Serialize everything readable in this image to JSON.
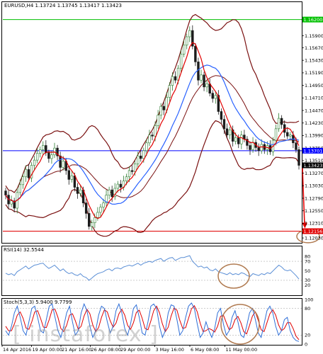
{
  "colors": {
    "background": "#ffffff",
    "candle_up": "#2e7d32",
    "candle_down": "#1b1b1b",
    "ma_fast": "#e00000",
    "ma_slow": "#2962ff",
    "bands": "#7a1010",
    "hline_green": "#00c000",
    "hline_blue": "#0000ff",
    "hline_red": "#e00000",
    "rsi": "#5b8fd6",
    "stoch_main": "#2f6fd8",
    "stoch_signal": "#e00000",
    "circle": "#b07a50",
    "arrow": "#e00000"
  },
  "chart_data": [
    {
      "type": "candlestick",
      "info": "EURUSD,H4  1.13724 1.13745 1.13417 1.13423",
      "y_range": [
        1.1195,
        1.1653
      ],
      "x_labels": [
        "14 Apr 2016",
        "19 Apr 00:00",
        "21 Apr 16:00",
        "26 Apr 08:00",
        "29 Apr 00:00",
        "3 May 16:00",
        "6 May 08:00",
        "11 May 00:00"
      ],
      "y_ticks": [
        "1.15900",
        "1.15670",
        "1.15430",
        "1.15190",
        "1.14950",
        "1.14710",
        "1.14470",
        "1.14230",
        "1.13990",
        "1.13750",
        "1.13510",
        "1.13270",
        "1.13030",
        "1.12790",
        "1.12550",
        "1.12310",
        "1.12030"
      ],
      "price_labels": [
        {
          "text": "1.16200",
          "value": 1.1621,
          "color": "#00c000"
        },
        {
          "text": "1.13701",
          "value": 1.137,
          "color": "#0000ff"
        },
        {
          "text": "1.13423",
          "value": 1.1342,
          "color": "#000000"
        },
        {
          "text": "1.12156",
          "value": 1.1216,
          "color": "#e00000"
        }
      ],
      "levels": [
        {
          "value": 1.1621,
          "color": "#00c000"
        },
        {
          "value": 1.137,
          "color": "#0000ff"
        },
        {
          "value": 1.1216,
          "color": "#e00000"
        }
      ],
      "close": [
        1.1285,
        1.1268,
        1.1274,
        1.126,
        1.129,
        1.1305,
        1.132,
        1.1334,
        1.1318,
        1.1342,
        1.1352,
        1.1365,
        1.1372,
        1.138,
        1.1366,
        1.1355,
        1.1362,
        1.1375,
        1.136,
        1.1338,
        1.135,
        1.1332,
        1.1315,
        1.1322,
        1.13,
        1.1288,
        1.1295,
        1.127,
        1.125,
        1.1225,
        1.1232,
        1.1242,
        1.1252,
        1.1262,
        1.127,
        1.1285,
        1.1295,
        1.1282,
        1.1298,
        1.1306,
        1.13,
        1.1312,
        1.132,
        1.1332,
        1.133,
        1.1345,
        1.136,
        1.1355,
        1.137,
        1.1385,
        1.14,
        1.1398,
        1.1418,
        1.1438,
        1.1455,
        1.1448,
        1.1472,
        1.1495,
        1.1512,
        1.1505,
        1.1528,
        1.1555,
        1.1572,
        1.1588,
        1.16,
        1.157,
        1.154,
        1.1505,
        1.1515,
        1.1492,
        1.1498,
        1.148,
        1.147,
        1.1476,
        1.1445,
        1.143,
        1.1412,
        1.14,
        1.141,
        1.1388,
        1.1395,
        1.1383,
        1.14,
        1.1392,
        1.138,
        1.1372,
        1.1386,
        1.1376,
        1.137,
        1.1382,
        1.1372,
        1.138,
        1.1368,
        1.139,
        1.1412,
        1.1432,
        1.142,
        1.1405,
        1.1398,
        1.14,
        1.1385,
        1.1372,
        1.1342
      ]
    },
    {
      "type": "line",
      "label": "RSI(14) 32.5544",
      "ylim": [
        0,
        100
      ],
      "y_ticks": [
        "80",
        "70",
        "50",
        "30",
        "20"
      ],
      "values": [
        45,
        42,
        44,
        40,
        48,
        52,
        56,
        60,
        54,
        58,
        62,
        63,
        65,
        66,
        60,
        55,
        58,
        62,
        56,
        50,
        54,
        48,
        44,
        46,
        42,
        40,
        44,
        38,
        36,
        30,
        35,
        40,
        44,
        46,
        48,
        52,
        54,
        50,
        55,
        56,
        54,
        58,
        60,
        62,
        60,
        63,
        66,
        62,
        66,
        68,
        70,
        68,
        72,
        74,
        76,
        70,
        74,
        77,
        78,
        72,
        75,
        78,
        78,
        80,
        82,
        70,
        64,
        58,
        60,
        56,
        58,
        52,
        50,
        54,
        48,
        46,
        44,
        42,
        46,
        42,
        44,
        42,
        46,
        44,
        40,
        38,
        44,
        42,
        40,
        44,
        42,
        46,
        44,
        50,
        56,
        62,
        58,
        52,
        50,
        52,
        46,
        40,
        32.55
      ]
    },
    {
      "type": "line",
      "label": "Stoch(5,3,3) 5.9400 9.7799",
      "ylim": [
        0,
        100
      ],
      "y_ticks": [
        "100",
        "80",
        "20",
        "0"
      ],
      "main": [
        30,
        20,
        40,
        70,
        85,
        60,
        30,
        20,
        50,
        80,
        85,
        60,
        30,
        25,
        55,
        85,
        90,
        60,
        30,
        15,
        40,
        70,
        85,
        50,
        20,
        30,
        70,
        90,
        75,
        40,
        15,
        30,
        65,
        85,
        80,
        50,
        25,
        40,
        75,
        90,
        70,
        35,
        20,
        45,
        80,
        88,
        60,
        25,
        20,
        50,
        85,
        90,
        80,
        40,
        15,
        30,
        70,
        88,
        85,
        55,
        20,
        30,
        60,
        85,
        92,
        80,
        45,
        15,
        25,
        50,
        30,
        15,
        35,
        70,
        80,
        45,
        20,
        30,
        60,
        75,
        50,
        20,
        15,
        40,
        70,
        80,
        55,
        25,
        15,
        45,
        75,
        85,
        70,
        40,
        20,
        30,
        55,
        60,
        30,
        15,
        8,
        5.94
      ],
      "signal": [
        40,
        30,
        30,
        45,
        65,
        72,
        58,
        36,
        33,
        50,
        72,
        75,
        58,
        38,
        37,
        55,
        77,
        78,
        60,
        35,
        28,
        42,
        65,
        68,
        52,
        33,
        40,
        63,
        78,
        68,
        43,
        28,
        37,
        60,
        77,
        72,
        52,
        38,
        47,
        68,
        78,
        65,
        42,
        33,
        48,
        71,
        76,
        58,
        35,
        32,
        52,
        75,
        85,
        70,
        45,
        28,
        38,
        63,
        81,
        76,
        53,
        35,
        37,
        58,
        79,
        86,
        72,
        47,
        28,
        30,
        35,
        32,
        27,
        40,
        62,
        65,
        48,
        32,
        37,
        55,
        62,
        48,
        28,
        23,
        42,
        63,
        72,
        53,
        32,
        28,
        48,
        68,
        77,
        65,
        43,
        30,
        35,
        48,
        48,
        35,
        18,
        9.78
      ]
    }
  ],
  "watermark": "instaforex.com"
}
